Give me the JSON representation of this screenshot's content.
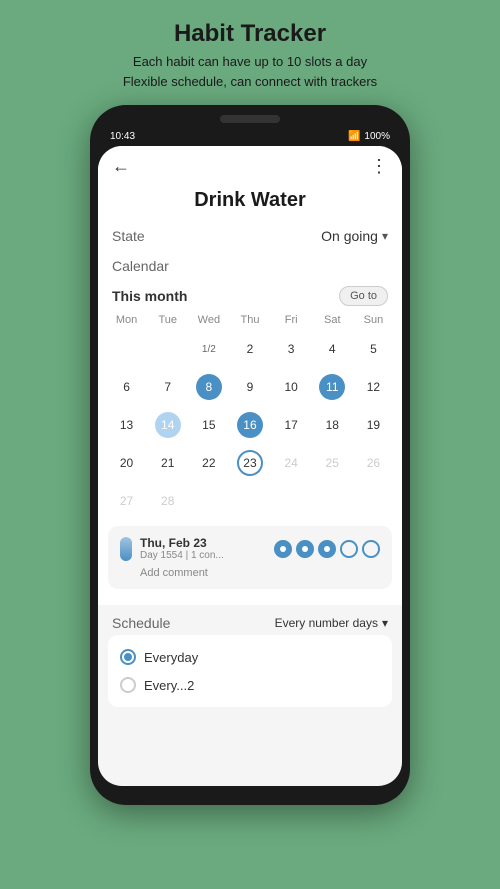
{
  "header": {
    "title": "Habit Tracker",
    "subtitle_line1": "Each habit can have up to 10 slots a day",
    "subtitle_line2": "Flexible schedule, can connect with trackers"
  },
  "status_bar": {
    "time": "10:43",
    "battery": "100%"
  },
  "top_bar": {
    "back_label": "←",
    "more_label": "⋮"
  },
  "habit": {
    "name": "Drink Water",
    "state_label": "State",
    "state_value": "On going"
  },
  "calendar": {
    "section_label": "Calendar",
    "month_label": "This month",
    "goto_label": "Go to",
    "day_headers": [
      "Mon",
      "Tue",
      "Wed",
      "Thu",
      "Fri",
      "Sat",
      "Sun"
    ],
    "rows": [
      [
        {
          "num": "1/2",
          "type": "half",
          "col": 3
        },
        {
          "num": "2",
          "type": "normal"
        },
        {
          "num": "3",
          "type": "normal"
        },
        {
          "num": "4",
          "type": "normal"
        },
        {
          "num": "5",
          "type": "normal"
        }
      ],
      [
        {
          "num": "6",
          "type": "normal"
        },
        {
          "num": "7",
          "type": "normal"
        },
        {
          "num": "8",
          "type": "filled-dark"
        },
        {
          "num": "9",
          "type": "normal"
        },
        {
          "num": "10",
          "type": "normal"
        },
        {
          "num": "11",
          "type": "filled-dark"
        },
        {
          "num": "12",
          "type": "normal"
        }
      ],
      [
        {
          "num": "13",
          "type": "normal"
        },
        {
          "num": "14",
          "type": "filled-light"
        },
        {
          "num": "15",
          "type": "normal"
        },
        {
          "num": "16",
          "type": "filled-dark"
        },
        {
          "num": "17",
          "type": "normal"
        },
        {
          "num": "18",
          "type": "normal"
        },
        {
          "num": "19",
          "type": "normal"
        }
      ],
      [
        {
          "num": "20",
          "type": "normal"
        },
        {
          "num": "21",
          "type": "normal"
        },
        {
          "num": "22",
          "type": "normal"
        },
        {
          "num": "23",
          "type": "today"
        },
        {
          "num": "24",
          "type": "faded"
        },
        {
          "num": "25",
          "type": "faded"
        },
        {
          "num": "26",
          "type": "faded"
        }
      ],
      [
        {
          "num": "27",
          "type": "faded"
        },
        {
          "num": "28",
          "type": "faded"
        }
      ]
    ]
  },
  "day_info": {
    "date": "Thu, Feb 23",
    "sub": "Day 1554 | 1 con...",
    "add_comment": "Add comment",
    "slots": [
      "filled",
      "filled",
      "filled",
      "empty",
      "empty"
    ]
  },
  "schedule": {
    "label": "Schedule",
    "value": "Every number days",
    "options": [
      {
        "label": "Everyday",
        "selected": true
      },
      {
        "label": "Every...2",
        "selected": false
      }
    ]
  }
}
